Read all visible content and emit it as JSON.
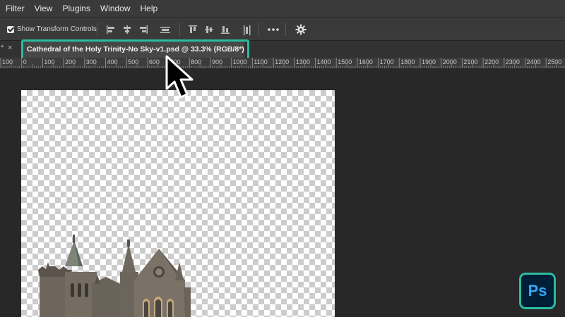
{
  "menu": {
    "items": [
      "Filter",
      "View",
      "Plugins",
      "Window",
      "Help"
    ]
  },
  "options": {
    "show_transform_label": "Show Transform Controls",
    "show_transform_checked": true,
    "align_icons": [
      "align-left-edges-icon",
      "align-horizontal-centers-icon",
      "align-right-edges-icon",
      "distribute-horizontal-icon",
      "align-top-edges-icon",
      "align-vertical-centers-icon",
      "align-bottom-edges-icon",
      "distribute-vertical-icon"
    ],
    "more_icon": "more-options-icon",
    "settings_icon": "gear-icon"
  },
  "tabs": {
    "stub_marker": "*",
    "stub_close": "×",
    "active": {
      "title": "Cathedral of the Holy Trinity-No Sky-v1.psd @ 33.3% (RGB/8*)",
      "close": "×"
    },
    "highlight_color": "#2bbba0"
  },
  "ruler": {
    "labels": [
      "100",
      "0",
      "100",
      "200",
      "300",
      "400",
      "500",
      "600",
      "700",
      "800",
      "900",
      "1000",
      "1100",
      "1200",
      "1300",
      "1400",
      "1500",
      "1600",
      "1700",
      "1800",
      "1900",
      "2000",
      "2100",
      "2200",
      "2300",
      "2400",
      "2500"
    ]
  },
  "canvas": {
    "background": "transparency-checkerboard",
    "content": "cathedral-image"
  },
  "badge": {
    "label": "Ps",
    "border_color": "#2bbba0",
    "text_color": "#31a8ff",
    "background": "#001e36"
  }
}
